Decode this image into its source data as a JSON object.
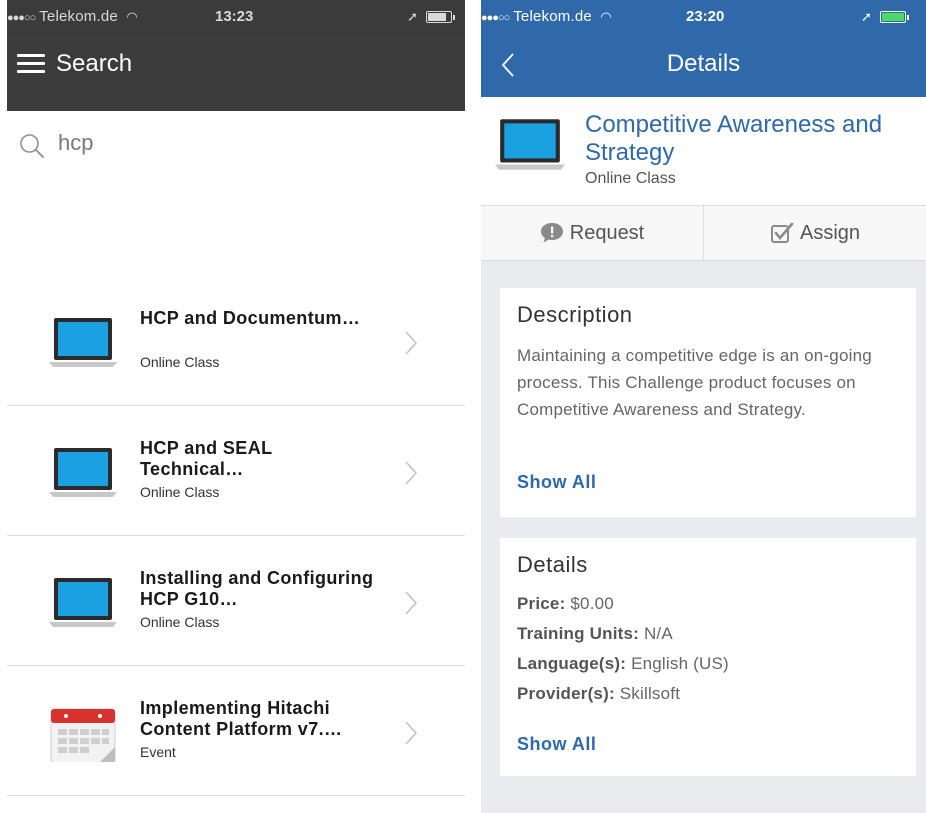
{
  "left": {
    "status": {
      "carrier": "Telekom.de",
      "time": "13:23",
      "signal_dots": "●●●○○"
    },
    "title": "Search",
    "search": {
      "value": "hcp"
    },
    "results": [
      {
        "title": "HCP and Documentum…",
        "type": "Online Class",
        "icon": "laptop-icon"
      },
      {
        "title": "HCP and SEAL Technical…",
        "type": "Online Class",
        "icon": "laptop-icon"
      },
      {
        "title": "Installing and Configuring HCP G10…",
        "type": "Online Class",
        "icon": "laptop-icon"
      },
      {
        "title": "Implementing Hitachi Content Platform v7.…",
        "type": "Event",
        "icon": "calendar-icon"
      }
    ]
  },
  "right": {
    "status": {
      "carrier": "Telekom.de",
      "time": "23:20",
      "signal_dots": "●●●○○"
    },
    "nav_title": "Details",
    "course": {
      "title": "Competitive Awareness and Strategy",
      "type": "Online Class"
    },
    "actions": {
      "request": "Request",
      "assign": "Assign"
    },
    "description": {
      "heading": "Description",
      "body": "Maintaining a competitive edge is an on-going process. This Challenge product focuses on Competitive Awareness and Strategy.",
      "show_all": "Show All"
    },
    "details": {
      "heading": "Details",
      "price_label": "Price:",
      "price_value": "$0.00",
      "units_label": "Training Units:",
      "units_value": "N/A",
      "language_label": "Language(s):",
      "language_value": "English (US)",
      "provider_label": "Provider(s):",
      "provider_value": "Skillsoft",
      "show_all": "Show All"
    }
  },
  "colors": {
    "left_header": "#3c3c3c",
    "nav_blue": "#2f69a9",
    "screen_blue": "#1ba1e2",
    "calendar_red": "#d9312f",
    "battery_green": "#4cd964"
  }
}
